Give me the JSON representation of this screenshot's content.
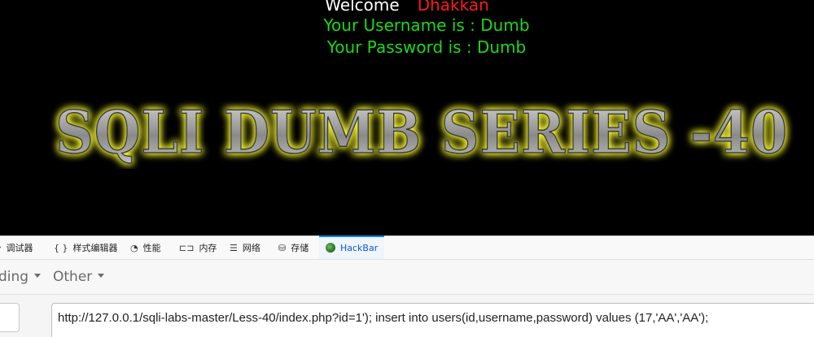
{
  "page": {
    "welcome_word": "Welcome",
    "welcome_name": "Dhakkan",
    "username_line": "Your Username is : Dumb",
    "password_line": "Your Password is : Dumb",
    "banner_text": "SQLI DUMB SERIES -40",
    "colors": {
      "background": "#000000",
      "welcome": "#ffffff",
      "name": "#ff1a1a",
      "credentials": "#1cd81c",
      "banner_glow": "#ffff33"
    }
  },
  "devtools": {
    "tabs": [
      {
        "icon": "debugger-icon",
        "glyph": "⏵",
        "label": "调试器"
      },
      {
        "icon": "style-editor-icon",
        "glyph": "{ }",
        "label": "样式编辑器"
      },
      {
        "icon": "performance-icon",
        "glyph": "◔",
        "label": "性能"
      },
      {
        "icon": "memory-icon",
        "glyph": "⊏⊐",
        "label": "内存"
      },
      {
        "icon": "network-icon",
        "glyph": "☰",
        "label": "网络"
      },
      {
        "icon": "storage-icon",
        "glyph": "⛁",
        "label": "存储"
      },
      {
        "icon": "hackbar-icon",
        "glyph": "",
        "label": "HackBar"
      }
    ],
    "active_tab": "HackBar"
  },
  "hackbar": {
    "menu_partial": "ding",
    "menu_other": "Other",
    "url_value": "http://127.0.0.1/sqli-labs-master/Less-40/index.php?id=1'); insert into users(id,username,password) values (17,'AA','AA');"
  }
}
